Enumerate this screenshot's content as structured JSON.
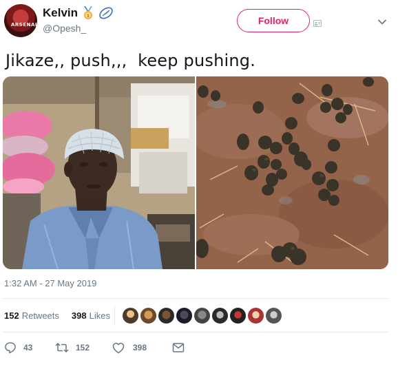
{
  "user": {
    "name": "Kelvin",
    "handle": "@Opesh_",
    "avatar_text": "ARSENAL"
  },
  "follow_label": "Follow",
  "tweet_text": "Jikaze,, push,,,  keep pushing.",
  "timestamp": "1:32 AM - 27 May 2019",
  "stats": {
    "retweets_count": "152",
    "retweets_label": "Retweets",
    "likes_count": "398",
    "likes_label": "Likes"
  },
  "actions": {
    "replies": "43",
    "retweets": "152",
    "likes": "398"
  },
  "colors": {
    "accent": "#e0245e",
    "secondary_text": "#657786",
    "divider": "#e6ecf0"
  },
  "icons": [
    "medal-icon",
    "rugby-ball-icon",
    "contact-card-icon",
    "chevron-down-icon",
    "reply-icon",
    "retweet-icon",
    "like-icon",
    "message-icon"
  ]
}
